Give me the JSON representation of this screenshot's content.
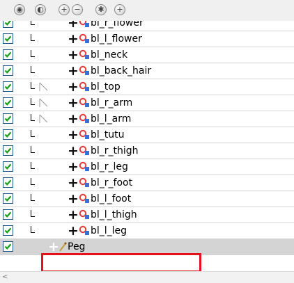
{
  "toolbar": {
    "buttons": [
      {
        "icon": "eye-all-icon",
        "glyph": "◉"
      },
      {
        "icon": "eye-toggle-icon",
        "glyph": "◐"
      },
      {
        "icon": "expand-icon",
        "glyph": "+"
      },
      {
        "icon": "collapse-icon",
        "glyph": "−"
      },
      {
        "icon": "add-layer-icon",
        "glyph": "✱"
      },
      {
        "icon": "add-peg-icon",
        "glyph": "+"
      }
    ]
  },
  "layers": [
    {
      "name": "bl_r_flower"
    },
    {
      "name": "bl_l_flower"
    },
    {
      "name": "bl_neck"
    },
    {
      "name": "bl_back_hair"
    },
    {
      "name": "bl_top"
    },
    {
      "name": "bl_r_arm"
    },
    {
      "name": "bl_l_arm"
    },
    {
      "name": "bl_tutu"
    },
    {
      "name": "bl_r_thigh"
    },
    {
      "name": "bl_r_leg"
    },
    {
      "name": "bl_r_foot"
    },
    {
      "name": "bl_l_foot"
    },
    {
      "name": "bl_l_thigh"
    },
    {
      "name": "bl_l_leg"
    }
  ],
  "peg_row": {
    "name": "Peg",
    "selected": true
  },
  "scrollbar": {
    "left_arrow": "<"
  },
  "colors": {
    "check": "#1b9e1b",
    "drawing_icon_red": "#e23a3a",
    "drawing_icon_blue": "#3a6fd8",
    "highlight": "#e8101a",
    "selected_row": "#d4d4d4"
  }
}
